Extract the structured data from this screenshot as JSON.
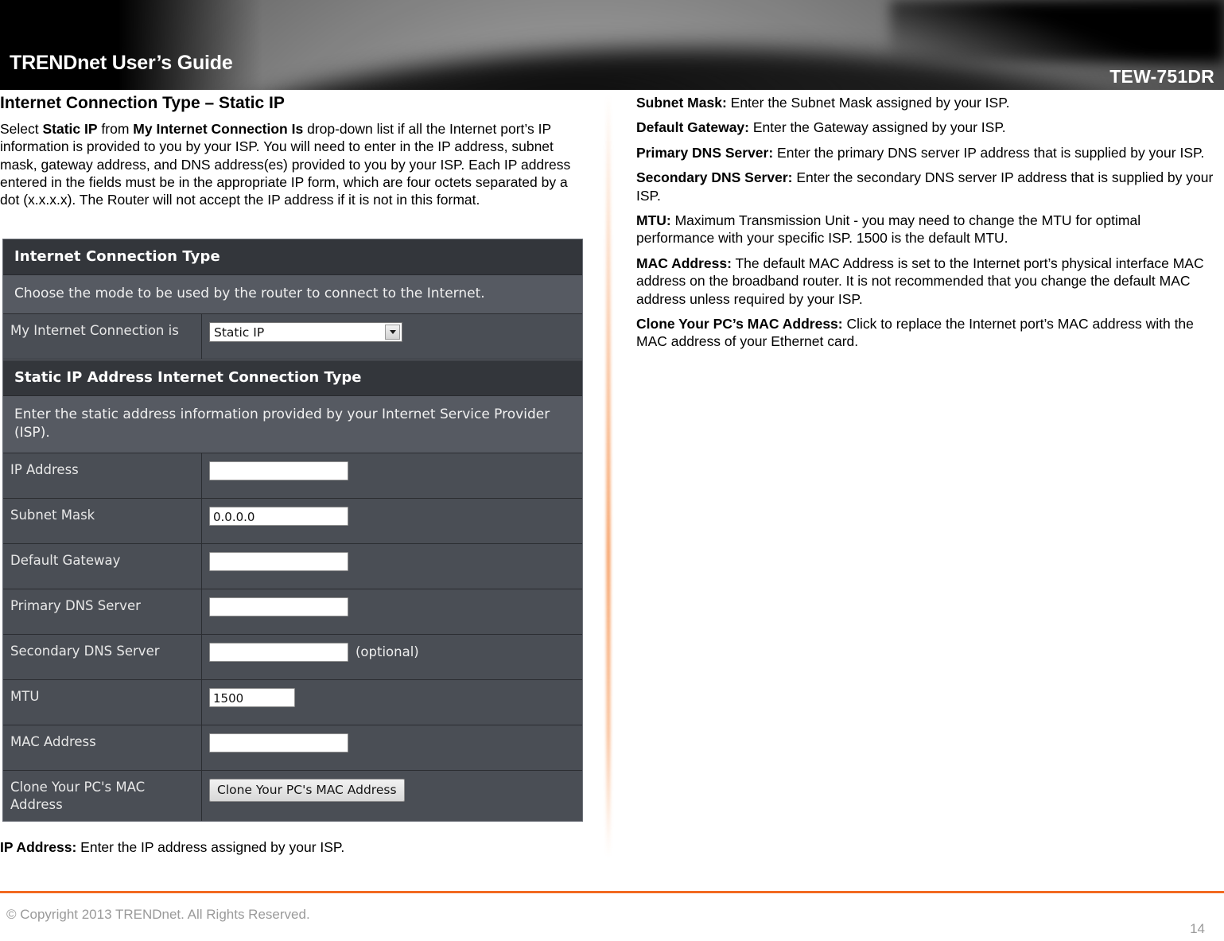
{
  "header": {
    "guide_title": "TRENDnet User’s Guide",
    "model": "TEW-751DR",
    "background_color": "#000000"
  },
  "left_column": {
    "heading": "Internet Connection Type – Static IP",
    "intro_parts": {
      "p1": "Select ",
      "b1": "Static IP",
      "p2": " from ",
      "b2": "My Internet Connection Is",
      "p3": " drop-down list if all the Internet port’s IP information is provided to you by your ISP. You will need to enter in the IP address, subnet mask, gateway address, and DNS address(es) provided to you by your ISP. Each IP address entered in the fields must be in the appropriate IP form, which are four octets separated by a dot (x.x.x.x). The Router will not accept the IP address if it is not in this format."
    },
    "ip_address_note": {
      "term": "IP Address:",
      "text": " Enter the IP address assigned by your ISP."
    }
  },
  "router_ui": {
    "panel1_title": "Internet Connection Type",
    "panel1_desc": "Choose the mode to be used by the router to connect to the Internet.",
    "connection_row": {
      "label": "My Internet Connection is",
      "selected_value": "Static IP"
    },
    "panel2_title": "Static IP Address Internet Connection Type",
    "panel2_desc": "Enter the static address information provided by your Internet Service Provider (ISP).",
    "fields": [
      {
        "label": "IP Address",
        "value": "",
        "suffix": ""
      },
      {
        "label": "Subnet Mask",
        "value": "0.0.0.0",
        "suffix": ""
      },
      {
        "label": "Default Gateway",
        "value": "",
        "suffix": ""
      },
      {
        "label": "Primary DNS Server",
        "value": "",
        "suffix": ""
      },
      {
        "label": "Secondary DNS Server",
        "value": "",
        "suffix": "(optional)"
      },
      {
        "label": "MTU",
        "value": "1500",
        "suffix": ""
      },
      {
        "label": "MAC Address",
        "value": "",
        "suffix": ""
      }
    ],
    "clone_row": {
      "label": "Clone Your PC's MAC Address",
      "button_label": "Clone Your PC's MAC Address"
    },
    "colors": {
      "header_bg": "#33363b",
      "desc_bg": "#565a62",
      "row_bg": "#4a4e55",
      "border": "#2b2d31"
    }
  },
  "right_column": {
    "entries": [
      {
        "term": "Subnet Mask:",
        "text": " Enter the Subnet Mask assigned by your ISP."
      },
      {
        "term": "Default Gateway:",
        "text": " Enter the Gateway assigned by your ISP."
      },
      {
        "term": "Primary DNS Server:",
        "text": " Enter the primary DNS server IP address that is supplied by your ISP."
      },
      {
        "term": "Secondary DNS Server:",
        "text": " Enter the secondary DNS server IP address that is supplied by your ISP."
      },
      {
        "term": "MTU:",
        "text": " Maximum Transmission Unit - you may need to change the MTU for optimal performance with your specific ISP. 1500 is the default MTU."
      },
      {
        "term": "MAC Address:",
        "text": "  The default MAC Address is set to the Internet port’s physical interface MAC address on the broadband router. It is not recommended that you change the default MAC address unless required by your ISP."
      },
      {
        "term": "Clone Your PC’s MAC Address:",
        "text": " Click to replace the Internet port’s MAC address with the MAC address of your Ethernet card."
      }
    ]
  },
  "footer": {
    "copyright": "© Copyright 2013 TRENDnet. All Rights Reserved.",
    "page_number": "14",
    "rule_color": "#f26a21"
  }
}
